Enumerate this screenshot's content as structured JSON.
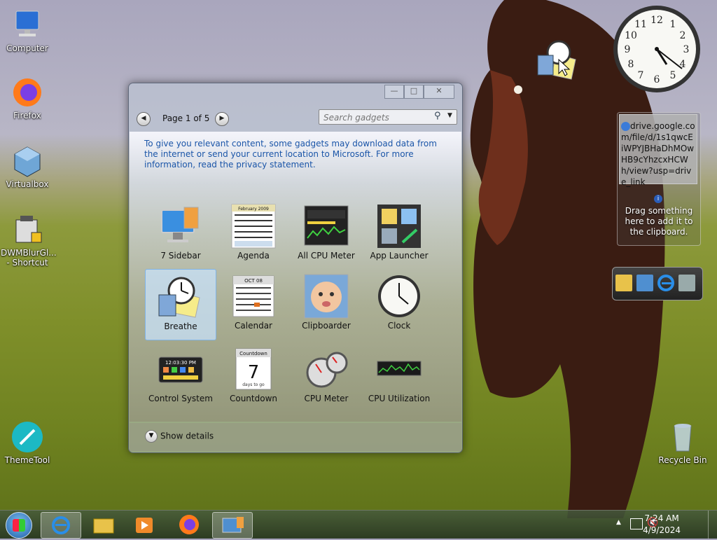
{
  "desktop": {
    "icons": [
      {
        "label": "Computer"
      },
      {
        "label": "Firefox"
      },
      {
        "label": "Virtualbox"
      },
      {
        "label": "DWMBlurGl... - Shortcut"
      },
      {
        "label": "ThemeTool"
      },
      {
        "label": "Recycle Bin"
      }
    ]
  },
  "gadget_window": {
    "minimize": "—",
    "maximize": "□",
    "close": "✕",
    "page_text": "Page 1 of 5",
    "search_placeholder": "Search gadgets",
    "notice": "To give you relevant content, some gadgets may download data from the internet or send your current location to Microsoft. For more information, read the privacy statement.",
    "gadgets": [
      {
        "label": "7 Sidebar"
      },
      {
        "label": "Agenda"
      },
      {
        "label": "All CPU Meter"
      },
      {
        "label": "App Launcher"
      },
      {
        "label": "Breathe",
        "selected": true
      },
      {
        "label": "Calendar"
      },
      {
        "label": "Clipboarder"
      },
      {
        "label": "Clock"
      },
      {
        "label": "Control System"
      },
      {
        "label": "Countdown"
      },
      {
        "label": "CPU Meter"
      },
      {
        "label": "CPU Utilization"
      }
    ],
    "show_details": "Show details"
  },
  "thumbs": {
    "countdown_title": "Countdown",
    "countdown_num": "7",
    "countdown_sub": "days to go",
    "control_time": "12:03:30 PM",
    "agenda_month": "February 2009",
    "calendar_month": "OCT 08"
  },
  "clipboard_gadget": {
    "content": "drive.google.com/file/d/1s1qwcEiWPYJBHaDhMOwHB9cYhzcxHCWh/view?usp=drive_link",
    "info": "Drag something here to add it to the clipboard."
  },
  "clock_gadget": {
    "numbers": [
      "12",
      "1",
      "2",
      "3",
      "4",
      "5",
      "6",
      "7",
      "8",
      "9",
      "10",
      "11"
    ]
  },
  "taskbar": {
    "time": "7:24 AM",
    "date": "4/9/2024"
  },
  "colors": {
    "link": "#1a55a8",
    "selection": "#c8e1fa"
  }
}
